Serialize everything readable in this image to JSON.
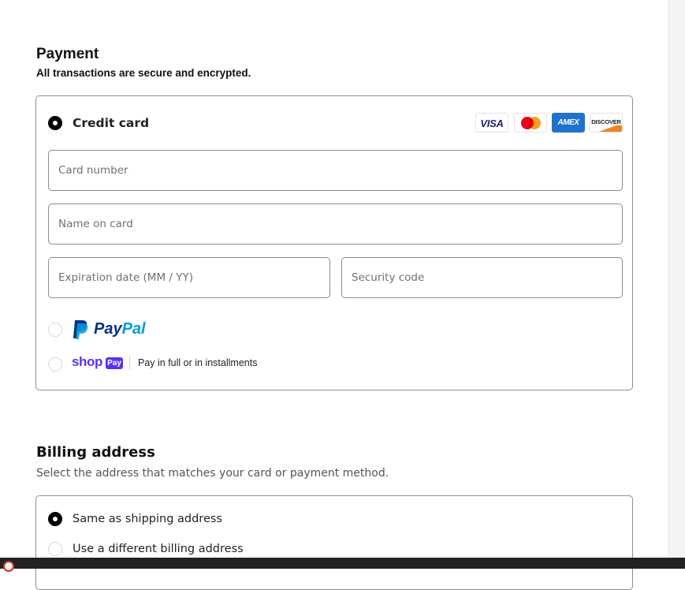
{
  "payment": {
    "title": "Payment",
    "subtitle": "All transactions are secure and encrypted.",
    "credit_card": {
      "label": "Credit card",
      "selected": true,
      "card_brands": [
        "VISA",
        "AMEX",
        "DISCOVER"
      ],
      "fields": {
        "card_number": {
          "placeholder": "Card number",
          "value": ""
        },
        "name_on_card": {
          "placeholder": "Name on card",
          "value": ""
        },
        "expiration": {
          "placeholder": "Expiration date (MM / YY)",
          "value": ""
        },
        "security_code": {
          "placeholder": "Security code",
          "value": ""
        }
      }
    },
    "paypal": {
      "label_pay": "Pay",
      "label_pal": "Pal",
      "selected": false
    },
    "shop_pay": {
      "label": "shop",
      "badge": "Pay",
      "description": "Pay in full or in installments",
      "selected": false
    }
  },
  "billing": {
    "title": "Billing address",
    "subtitle": "Select the address that matches your card or payment method.",
    "options": [
      {
        "label": "Same as shipping address",
        "selected": true
      },
      {
        "label": "Use a different billing address",
        "selected": false
      }
    ]
  },
  "colors": {
    "paypal_dark": "#003087",
    "paypal_light": "#009cde",
    "shop_purple": "#5a31f4",
    "amex_blue": "#1f72cd",
    "border": "#8c8c8c"
  }
}
